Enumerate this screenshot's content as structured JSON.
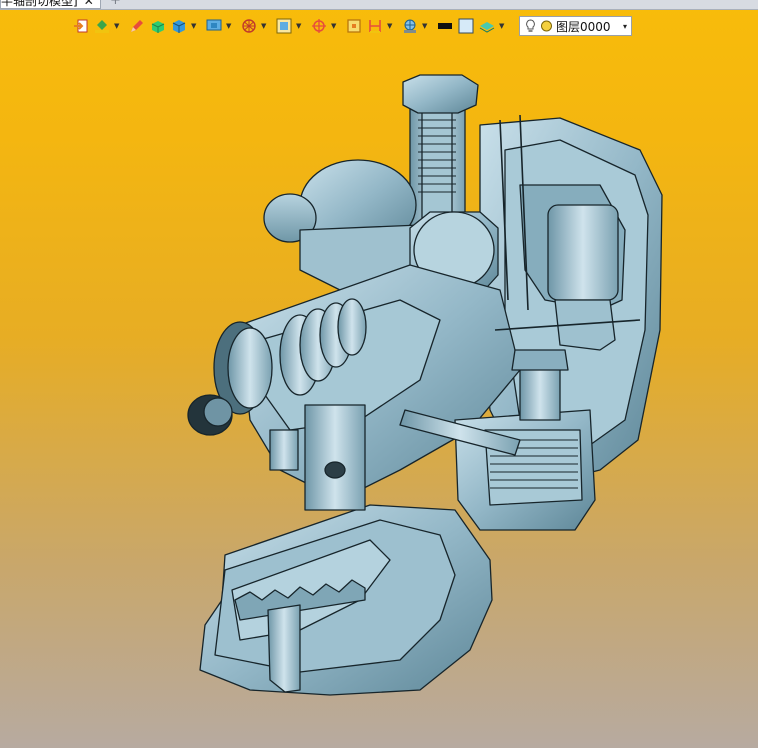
{
  "tab": {
    "title": "半轴剖切模型]",
    "close": "✕",
    "add": "+"
  },
  "toolbar": {
    "buttons": [
      {
        "icon": "import-icon"
      },
      {
        "icon": "paint-bucket-icon",
        "dropdown": true
      },
      {
        "icon": "pencil-icon"
      },
      {
        "icon": "solid-box-icon"
      },
      {
        "icon": "cube-icon",
        "dropdown": true
      },
      {
        "icon": "monitor-cube-icon",
        "dropdown": true
      },
      {
        "icon": "wireframe-sphere-icon",
        "dropdown": true
      },
      {
        "icon": "frame-icon",
        "dropdown": true
      },
      {
        "icon": "crosshair-icon",
        "dropdown": true
      },
      {
        "icon": "square-icon"
      },
      {
        "icon": "dimension-icon",
        "dropdown": true
      },
      {
        "icon": "globe-plate-icon",
        "dropdown": true
      },
      {
        "icon": "black-rect-icon"
      },
      {
        "icon": "light-square-icon"
      },
      {
        "icon": "layers-icon",
        "dropdown": true
      }
    ],
    "layer": {
      "name": "图层0000",
      "caret": "▾"
    }
  },
  "colors": {
    "accent": "#f8bc0a",
    "model": "#8fb2c2",
    "model_dark": "#5f8797",
    "model_light": "#c7dde6"
  }
}
